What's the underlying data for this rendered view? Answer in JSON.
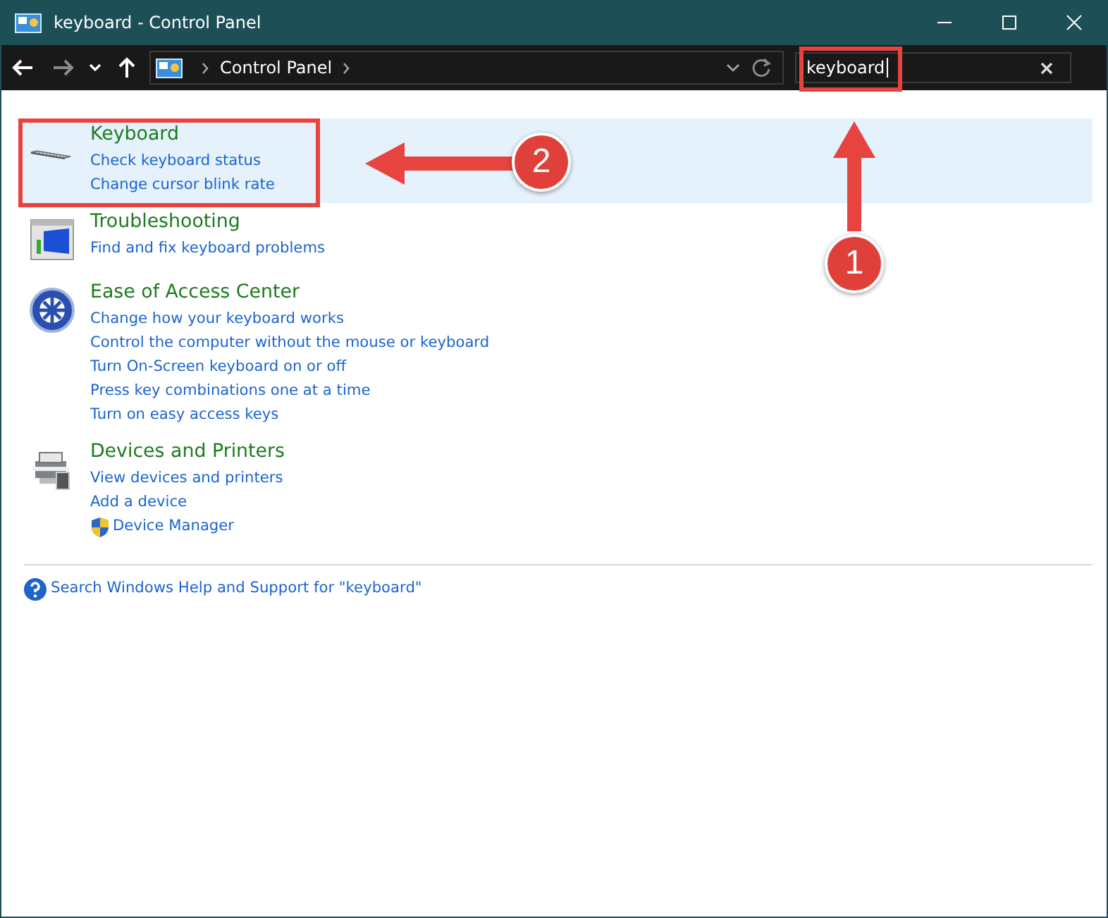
{
  "window": {
    "title": "keyboard - Control Panel"
  },
  "address": {
    "path": [
      "Control Panel"
    ]
  },
  "search": {
    "value": "keyboard"
  },
  "results": [
    {
      "kind": "keyboard",
      "title": "Keyboard",
      "selected": true,
      "links": [
        {
          "text": "Check keyboard status"
        },
        {
          "text": "Change cursor blink rate"
        }
      ]
    },
    {
      "kind": "troubleshooting",
      "title": "Troubleshooting",
      "selected": false,
      "links": [
        {
          "text": "Find and fix keyboard problems"
        }
      ]
    },
    {
      "kind": "ease",
      "title": "Ease of Access Center",
      "selected": false,
      "links": [
        {
          "text": "Change how your keyboard works"
        },
        {
          "text": "Control the computer without the mouse or keyboard"
        },
        {
          "text": "Turn On-Screen keyboard on or off"
        },
        {
          "text": "Press key combinations one at a time"
        },
        {
          "text": "Turn on easy access keys"
        }
      ]
    },
    {
      "kind": "devices",
      "title": "Devices and Printers",
      "selected": false,
      "links": [
        {
          "text": "View devices and printers"
        },
        {
          "text": "Add a device"
        },
        {
          "text": "Device Manager",
          "kind": "admin"
        }
      ]
    }
  ],
  "help_link": "Search Windows Help and Support for \"keyboard\"",
  "callouts": [
    {
      "number": "1"
    },
    {
      "number": "2"
    }
  ]
}
